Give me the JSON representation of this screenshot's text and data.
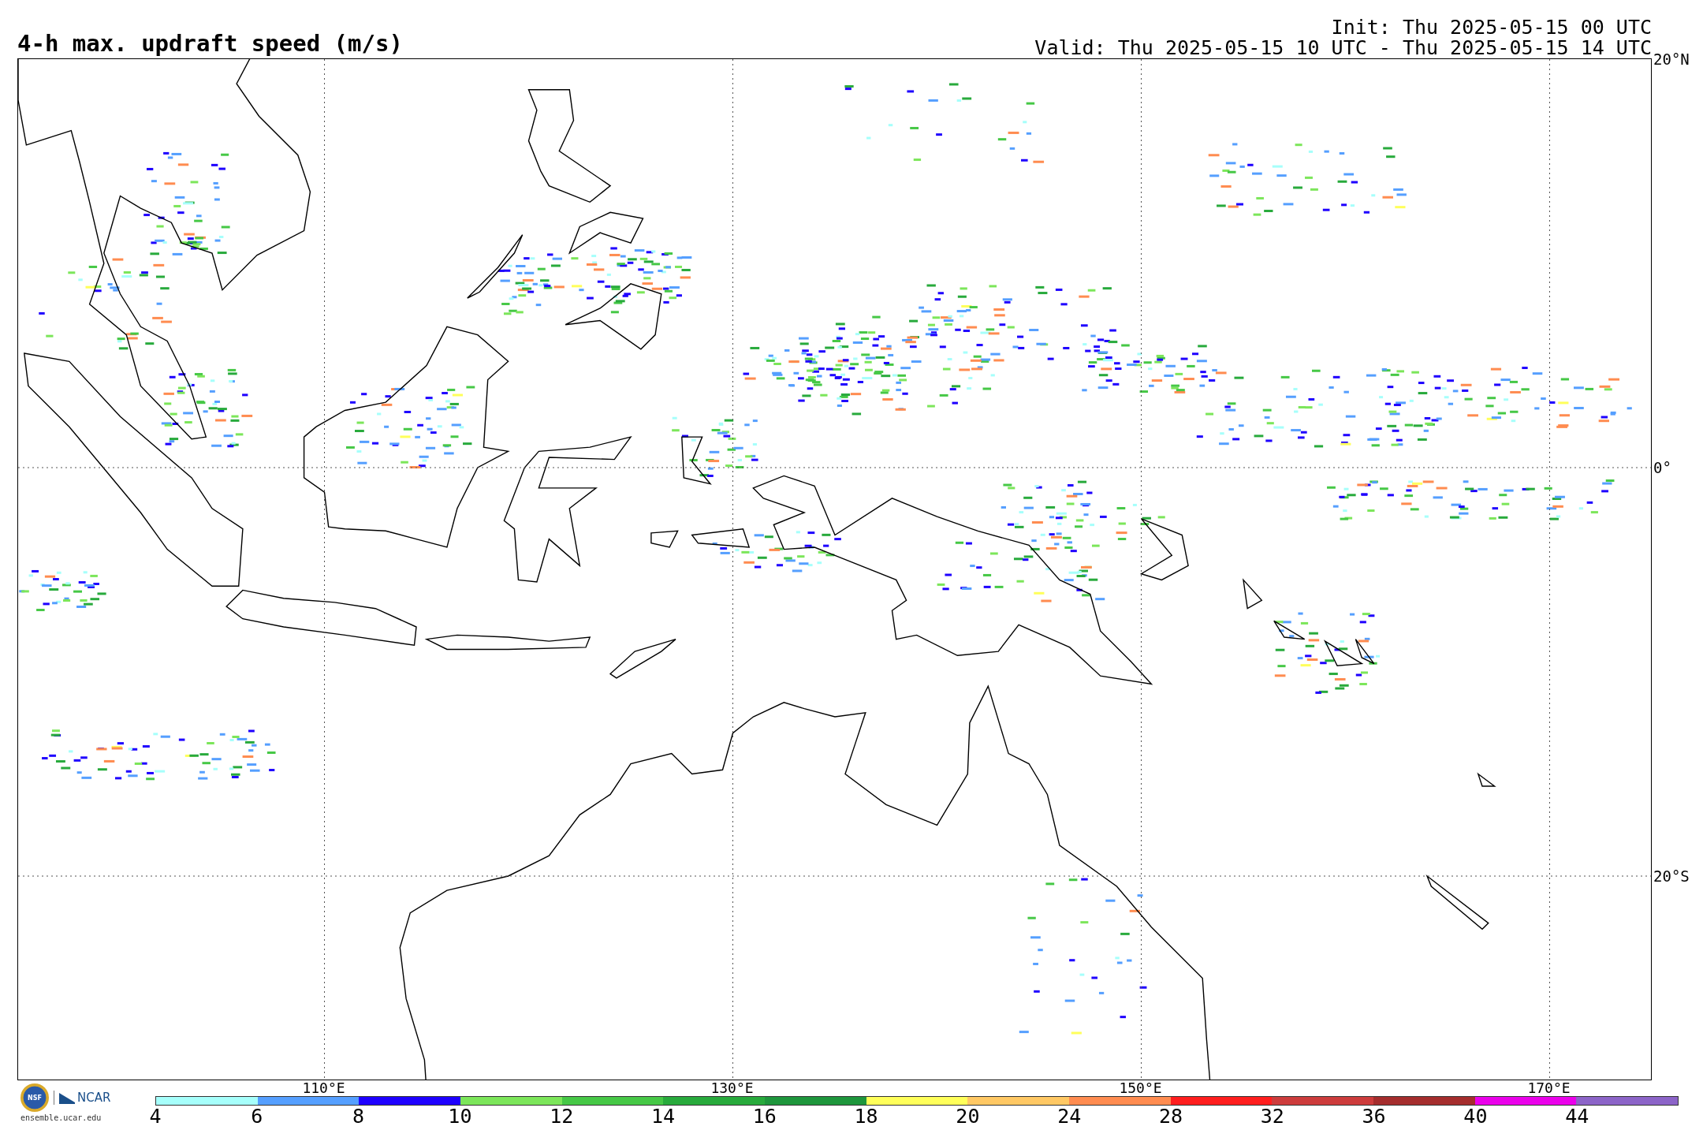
{
  "title": "4-h max. updraft speed (m/s)",
  "init": "Init: Thu 2025-05-15 00 UTC",
  "valid": "Valid: Thu 2025-05-15 10 UTC - Thu 2025-05-15 14 UTC",
  "lat_labels": [
    "20°N",
    "0°",
    "20°S"
  ],
  "lon_labels": [
    "110°E",
    "130°E",
    "150°E",
    "170°E"
  ],
  "logos": {
    "nsf": "NSF",
    "ncar": "NCAR",
    "site": "ensemble.ucar.edu"
  },
  "colorbar": [
    {
      "label": "4",
      "color": "#a6fffb"
    },
    {
      "label": "6",
      "color": "#559fff"
    },
    {
      "label": "8",
      "color": "#1e00ff"
    },
    {
      "label": "10",
      "color": "#7ce65a"
    },
    {
      "label": "12",
      "color": "#46c846"
    },
    {
      "label": "14",
      "color": "#28aa3c"
    },
    {
      "label": "16",
      "color": "#1e963c"
    },
    {
      "label": "18",
      "color": "#ffff5a"
    },
    {
      "label": "20",
      "color": "#ffc864"
    },
    {
      "label": "24",
      "color": "#ff8c50"
    },
    {
      "label": "28",
      "color": "#ff1e1e"
    },
    {
      "label": "32",
      "color": "#cd3c3c"
    },
    {
      "label": "36",
      "color": "#a52d2d"
    },
    {
      "label": "40",
      "color": "#eb00eb"
    },
    {
      "label": "44",
      "color": "#8c64c8"
    }
  ]
}
